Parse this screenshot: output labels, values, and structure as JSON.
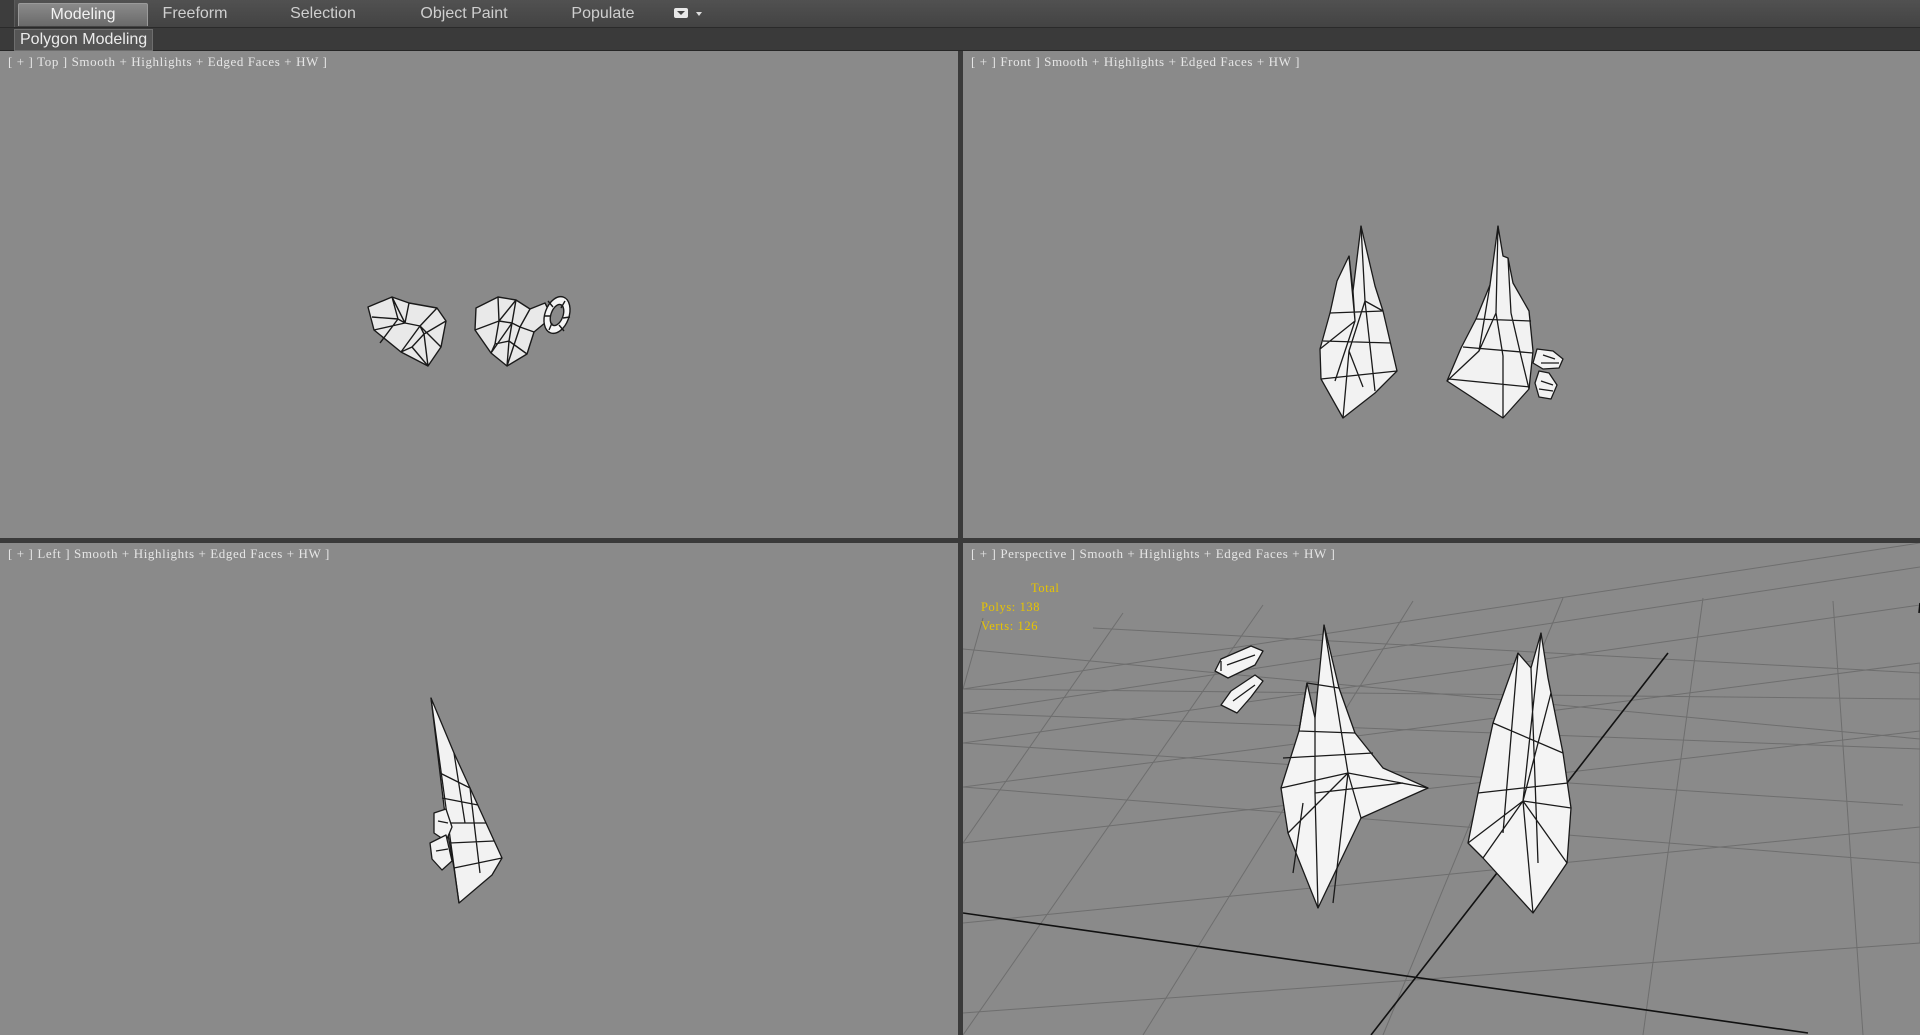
{
  "ribbon": {
    "tabs": [
      {
        "label": "Modeling",
        "active": true
      },
      {
        "label": "Freeform",
        "active": false
      },
      {
        "label": "Selection",
        "active": false
      },
      {
        "label": "Object Paint",
        "active": false
      },
      {
        "label": "Populate",
        "active": false
      }
    ],
    "panel_label": "Polygon Modeling"
  },
  "viewports": {
    "top": {
      "label": "[ + ] Top ] Smooth + Highlights + Edged Faces + HW ]"
    },
    "front": {
      "label": "[ + ] Front ] Smooth + Highlights + Edged Faces + HW ]"
    },
    "left": {
      "label": "[ + ] Left ] Smooth + Highlights + Edged Faces + HW ]"
    },
    "perspective": {
      "label": "[ + ] Perspective ] Smooth + Highlights + Edged Faces + HW ]"
    }
  },
  "stats": {
    "title": "Total",
    "polys": "Polys: 138",
    "verts": "Verts: 126"
  },
  "colors": {
    "viewport_bg": "#8a8a8a",
    "stats_text": "#e8c400",
    "mesh_fill": "#f4f4f4",
    "wire": "#1a1a1a"
  }
}
